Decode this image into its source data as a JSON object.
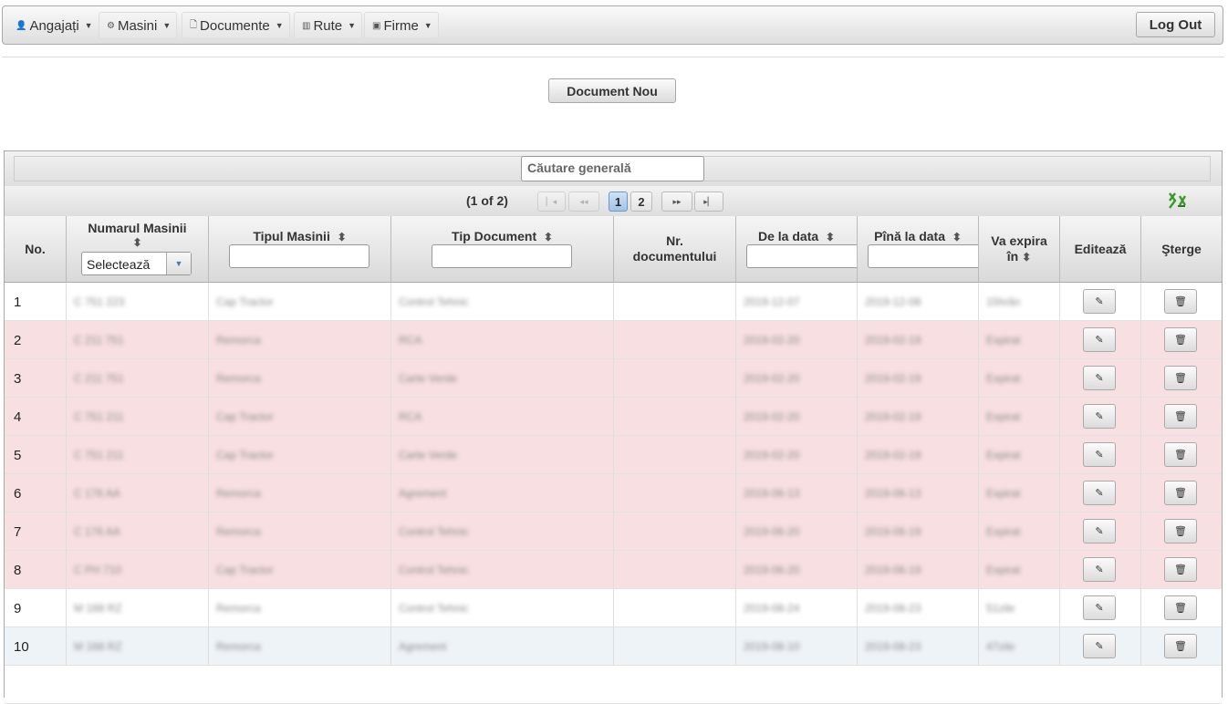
{
  "menu": [
    {
      "label": "Angajați",
      "icon": "user-icon",
      "glyph": "👤"
    },
    {
      "label": "Masini",
      "icon": "gear-icon",
      "glyph": "⚙"
    },
    {
      "label": "Documente",
      "icon": "document-icon",
      "glyph": "🗋"
    },
    {
      "label": "Rute",
      "icon": "book-icon",
      "glyph": "▥"
    },
    {
      "label": "Firme",
      "icon": "company-icon",
      "glyph": "▣"
    }
  ],
  "logout_label": "Log Out",
  "new_document_label": "Document Nou",
  "search": {
    "placeholder": "Căutare generală"
  },
  "pager": {
    "info": "(1 of 2)",
    "pages": [
      "1",
      "2"
    ],
    "current_page": 1,
    "first": "▏◂",
    "prev": "◂◂",
    "next": "▸▸",
    "last": "▸▏"
  },
  "export_icon": "excel-export-icon",
  "columns": {
    "no": "No.",
    "numar": "Numarul Masinii",
    "tip_masina": "Tipul Masinii",
    "tip_doc": "Tip Document",
    "nr_doc": "Nr. documentului",
    "de_la": "De la data",
    "pana_la": "Pînă la data",
    "expira": "Va expira în",
    "edit": "Editează",
    "delete": "Şterge"
  },
  "filter_select_value": "Selectează",
  "sort_glyph": "⬍",
  "rows": [
    {
      "no": "1",
      "numar": "C 751 223",
      "tip": "Cap Tractor",
      "doc": "Control Tehnic",
      "nr": "",
      "de": "2019-12-07",
      "pana": "2019-12-08",
      "exp": "15hrăn",
      "status": "ok"
    },
    {
      "no": "2",
      "numar": "C 211 751",
      "tip": "Remorca",
      "doc": "RCA",
      "nr": "",
      "de": "2019-02-20",
      "pana": "2019-02-19",
      "exp": "Expirat",
      "status": "exp"
    },
    {
      "no": "3",
      "numar": "C 211 751",
      "tip": "Remorca",
      "doc": "Carte Verde",
      "nr": "",
      "de": "2019-02-20",
      "pana": "2019-02-19",
      "exp": "Expirat",
      "status": "exp"
    },
    {
      "no": "4",
      "numar": "C 751 211",
      "tip": "Cap Tractor",
      "doc": "RCA",
      "nr": "",
      "de": "2019-02-20",
      "pana": "2019-02-19",
      "exp": "Expirat",
      "status": "exp"
    },
    {
      "no": "5",
      "numar": "C 751 211",
      "tip": "Cap Tractor",
      "doc": "Carte Verde",
      "nr": "",
      "de": "2019-02-20",
      "pana": "2019-02-19",
      "exp": "Expirat",
      "status": "exp"
    },
    {
      "no": "6",
      "numar": "C 176 AA",
      "tip": "Remorca",
      "doc": "Agrement",
      "nr": "",
      "de": "2019-06-13",
      "pana": "2019-06-13",
      "exp": "Expirat",
      "status": "exp"
    },
    {
      "no": "7",
      "numar": "C 176 AA",
      "tip": "Remorca",
      "doc": "Control Tehnic",
      "nr": "",
      "de": "2019-06-20",
      "pana": "2019-06-19",
      "exp": "Expirat",
      "status": "exp"
    },
    {
      "no": "8",
      "numar": "C PH 710",
      "tip": "Cap Tractor",
      "doc": "Control Tehnic",
      "nr": "",
      "de": "2019-06-20",
      "pana": "2019-06-19",
      "exp": "Expirat",
      "status": "exp"
    },
    {
      "no": "9",
      "numar": "M 168 RZ",
      "tip": "Remorca",
      "doc": "Control Tehnic",
      "nr": "",
      "de": "2019-08-24",
      "pana": "2019-08-23",
      "exp": "51zile",
      "status": "ok"
    },
    {
      "no": "10",
      "numar": "M 168 RZ",
      "tip": "Remorca",
      "doc": "Agrement",
      "nr": "",
      "de": "2019-08-10",
      "pana": "2019-08-23",
      "exp": "47zile",
      "status": "alt"
    }
  ]
}
